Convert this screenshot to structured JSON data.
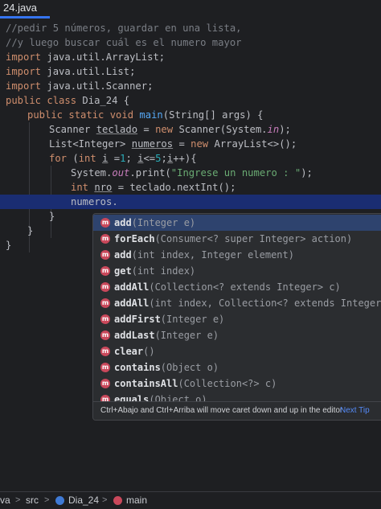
{
  "tab": {
    "file_name": "24.java"
  },
  "code": {
    "l1": "//pedir 5 números, guardar en una lista,",
    "l2": "//y luego buscar cuál es el numero mayor",
    "imp1_kw": "import",
    "imp1": " java.util.ArrayList;",
    "imp2_kw": "import",
    "imp2": " java.util.List;",
    "imp3_kw": "import",
    "imp3": " java.util.Scanner;",
    "cls_kw": "public class",
    "cls": " Dia_24 {",
    "main_kw": "public static void",
    "main_fn": "main",
    "main_rest": "(String[] args) {",
    "sc_type": "Scanner ",
    "sc_var": "teclado",
    "sc_eq": " = ",
    "sc_new": "new",
    "sc_rest": " Scanner(System.",
    "sc_in": "in",
    "sc_end": ");",
    "li_type": "List<Integer> ",
    "li_var": "numeros",
    "li_eq": " = ",
    "li_new": "new",
    "li_rest": " ArrayList<>();",
    "for_kw": "for",
    "for_open": " (",
    "for_int": "int",
    "for_i": "i",
    "for_eq": " =",
    "for_one": "1",
    "for_semi": "; ",
    "for_i2": "i",
    "for_le": "<=",
    "for_five": "5",
    "for_semi2": ";",
    "for_i3": "i",
    "for_end": "++){",
    "pr_a": "System.",
    "pr_out": "out",
    "pr_b": ".print(",
    "pr_str": "\"Ingrese un numero : \"",
    "pr_end": ");",
    "nro_int": "int",
    "nro_var": "nro",
    "nro_rest": " = teclado.nextInt();",
    "cur": "numeros.",
    "close1": "}",
    "close2": "}",
    "close3": "}"
  },
  "completion": {
    "items": [
      {
        "name": "add",
        "params": "(Integer e)"
      },
      {
        "name": "forEach",
        "params": "(Consumer<? super Integer> action)"
      },
      {
        "name": "add",
        "params": "(int index, Integer element)"
      },
      {
        "name": "get",
        "params": "(int index)"
      },
      {
        "name": "addAll",
        "params": "(Collection<? extends Integer> c)"
      },
      {
        "name": "addAll",
        "params": "(int index, Collection<? extends Integer> c)"
      },
      {
        "name": "addFirst",
        "params": "(Integer e)"
      },
      {
        "name": "addLast",
        "params": "(Integer e)"
      },
      {
        "name": "clear",
        "params": "()"
      },
      {
        "name": "contains",
        "params": "(Object o)"
      },
      {
        "name": "containsAll",
        "params": "(Collection<?> c)"
      },
      {
        "name": "equals",
        "params": "(Object o)"
      }
    ],
    "icon_letter": "m",
    "hint": "Ctrl+Abajo and Ctrl+Arriba will move caret down and up in the editor",
    "next_tip": "Next Tip"
  },
  "status": {
    "crumbs": [
      "va",
      "src",
      "Dia_24",
      "main"
    ],
    "sep": ">"
  },
  "colors": {
    "accent": "#3574f0",
    "method_icon": "#c9485b",
    "selection": "#2e436e"
  }
}
